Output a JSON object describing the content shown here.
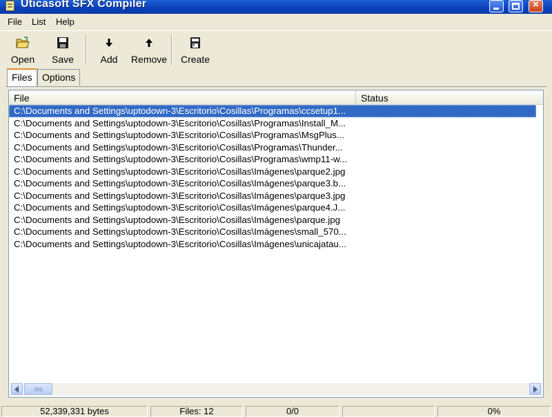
{
  "window": {
    "title": "Uticasoft SFX Compiler",
    "close_glyph": "×"
  },
  "menu": [
    "File",
    "List",
    "Help"
  ],
  "toolbar": {
    "open": "Open",
    "save": "Save",
    "add": "Add",
    "remove": "Remove",
    "create": "Create"
  },
  "tabs": [
    "Files",
    "Options"
  ],
  "list": {
    "columns": [
      "File",
      "Status"
    ],
    "rows": [
      "C:\\Documents and Settings\\uptodown-3\\Escritorio\\Cosillas\\Programas\\ccsetup1...",
      "C:\\Documents and Settings\\uptodown-3\\Escritorio\\Cosillas\\Programas\\Install_M...",
      "C:\\Documents and Settings\\uptodown-3\\Escritorio\\Cosillas\\Programas\\MsgPlus...",
      "C:\\Documents and Settings\\uptodown-3\\Escritorio\\Cosillas\\Programas\\Thunder...",
      "C:\\Documents and Settings\\uptodown-3\\Escritorio\\Cosillas\\Programas\\wmp11-w...",
      "C:\\Documents and Settings\\uptodown-3\\Escritorio\\Cosillas\\Imágenes\\parque2.jpg",
      "C:\\Documents and Settings\\uptodown-3\\Escritorio\\Cosillas\\Imágenes\\parque3.b...",
      "C:\\Documents and Settings\\uptodown-3\\Escritorio\\Cosillas\\Imágenes\\parque3.jpg",
      "C:\\Documents and Settings\\uptodown-3\\Escritorio\\Cosillas\\Imágenes\\parque4.J...",
      "C:\\Documents and Settings\\uptodown-3\\Escritorio\\Cosillas\\Imágenes\\parque.jpg",
      "C:\\Documents and Settings\\uptodown-3\\Escritorio\\Cosillas\\Imágenes\\small_570...",
      "C:\\Documents and Settings\\uptodown-3\\Escritorio\\Cosillas\\Imágenes\\unicajatau..."
    ],
    "selected_index": 0
  },
  "statusbar": {
    "size": "52,339,331 bytes",
    "files": "Files: 12",
    "progress_count": "0/0",
    "blank": "",
    "percent": "0%"
  },
  "colors": {
    "selection": "#316ac5",
    "titlebar": "#0a3fb8",
    "face": "#ece9d8"
  }
}
